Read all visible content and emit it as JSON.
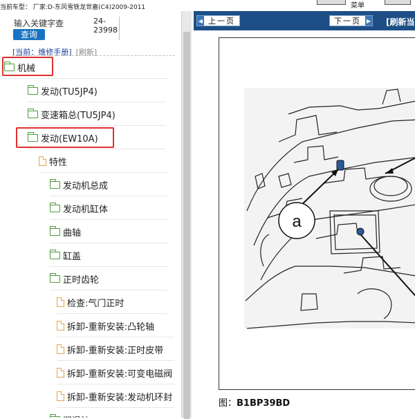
{
  "topbar": {
    "vehicle": "当前车型： 厂家:D-东风雪铁龙世嘉(C4)2009-2011",
    "menu_partial": "菜单"
  },
  "search": {
    "keyword_label": "输入关键字查",
    "button_label": "查询",
    "code": "24-23998"
  },
  "breadcrumb": {
    "current": "[当前：维修手册]",
    "refresh": "[刷新]"
  },
  "tree": {
    "nodes": [
      {
        "label": "机械",
        "icon": "folder-icon",
        "highlighted": true
      },
      {
        "label": "发动(TU5JP4)",
        "icon": "folder-icon"
      },
      {
        "label": "变速箱总(TU5JP4)",
        "icon": "folder-icon"
      },
      {
        "label": "发动(EW10A)",
        "icon": "folder-icon",
        "highlighted": true
      },
      {
        "label": "特性",
        "icon": "document-icon"
      },
      {
        "label": "发动机总成",
        "icon": "folder-icon"
      },
      {
        "label": "发动机缸体",
        "icon": "folder-icon"
      },
      {
        "label": "曲轴",
        "icon": "folder-icon"
      },
      {
        "label": "缸盖",
        "icon": "folder-icon"
      },
      {
        "label": "正时齿轮",
        "icon": "folder-icon"
      },
      {
        "label": "检查:气门正时",
        "icon": "document-icon"
      },
      {
        "label": "拆卸-重新安装:凸轮轴",
        "icon": "document-icon"
      },
      {
        "label": "拆卸-重新安装:正时皮带",
        "icon": "document-icon"
      },
      {
        "label": "拆卸-重新安装:可变电磁阀",
        "icon": "document-icon"
      },
      {
        "label": "拆卸-重新安装:发动机环封",
        "icon": "document-icon"
      },
      {
        "label": "润滑油",
        "icon": "folder-icon"
      }
    ]
  },
  "viewer": {
    "prev_label": "上一页",
    "next_label": "下一页",
    "refresh_label": "[刷新当",
    "figure_callout": "a",
    "caption_prefix": "图：",
    "caption_code": "B1BP39BD"
  },
  "colors": {
    "highlight": "#e03030",
    "folder": "#4e9a3a",
    "document": "#e6a24a",
    "nav_bar": "#1d4f86",
    "search_button": "#1a73c2"
  }
}
